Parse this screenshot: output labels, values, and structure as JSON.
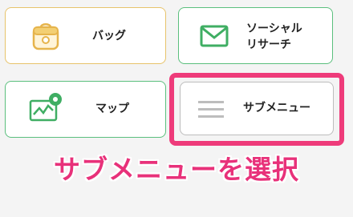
{
  "menu": {
    "bag": {
      "label": "バッグ",
      "icon": "bag-icon"
    },
    "social_research": {
      "label_line1": "ソーシャル",
      "label_line2": "リサーチ",
      "icon": "mail-icon"
    },
    "map": {
      "label": "マップ",
      "icon": "map-chart-icon"
    },
    "submenu": {
      "label": "サブメニュー",
      "icon": "hamburger-menu-icon"
    }
  },
  "caption": "サブメニューを選択",
  "colors": {
    "highlight": "#ee3b7a",
    "bag_border": "#e7c36a",
    "green_border": "#5bbf7d",
    "submenu_border": "#bdbdbd"
  }
}
